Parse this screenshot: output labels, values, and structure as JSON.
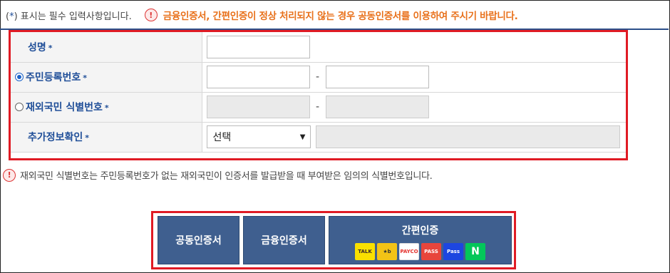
{
  "notice": {
    "required_prefix": "(",
    "required_star": "*",
    "required_suffix": ") 표시는 필수 입력사항입니다.",
    "warning_text": "금융인증서, 간편인증이 정상 처리되지 않는 경우 공동인증서를 이용하여 주시기 바랍니다."
  },
  "form": {
    "name_label": "성명",
    "rrn_label": "주민등록번호",
    "foreign_label": "재외국민 식별번호",
    "extra_label": "추가정보확인",
    "required_mark": "*",
    "dash": "-",
    "extra_select": {
      "selected": "선택"
    },
    "id_type_selected": "rrn"
  },
  "info": {
    "text": "재외국민 식별번호는 주민등록번호가 없는 재외국민이 인증서를 발급받을 때 부여받은 임의의 식별번호입니다."
  },
  "buttons": {
    "pki": "공동인증서",
    "fin": "금융인증서",
    "simple": "간편인증",
    "logos": [
      {
        "name": "kakao-talk-logo",
        "text": "TALK"
      },
      {
        "name": "kb-logo",
        "text": "★b"
      },
      {
        "name": "payco-logo",
        "text": "PAYCO"
      },
      {
        "name": "pass-logo",
        "text": "PASS"
      },
      {
        "name": "samsung-pass-logo",
        "text": "Pass"
      },
      {
        "name": "naver-logo",
        "text": "N"
      }
    ]
  },
  "colors": {
    "warning_orange": "#e8711b",
    "label_blue": "#1f4e98",
    "button_bg": "#3f5f8f",
    "highlight_red": "#e01b24"
  }
}
